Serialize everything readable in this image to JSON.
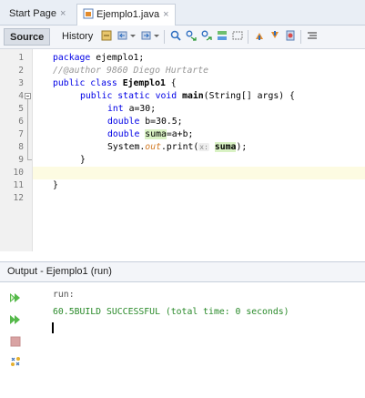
{
  "tabs": [
    {
      "label": "Start Page",
      "active": false
    },
    {
      "label": "Ejemplo1.java",
      "active": true
    }
  ],
  "close_glyph": "×",
  "toolbar": {
    "source_label": "Source",
    "history_label": "History"
  },
  "line_numbers": [
    "1",
    "2",
    "3",
    "4",
    "5",
    "6",
    "7",
    "8",
    "9",
    "10",
    "11",
    "12"
  ],
  "code": {
    "l1_kw": "package",
    "l1_rest": " ejemplo1;",
    "l2": "//@author 9860 Diego Hurtarte",
    "l3_kw": "public class",
    "l3_name": "Ejemplo1",
    "l3_rest": " {",
    "l4_kw": "public static void",
    "l4_name": "main",
    "l4_rest": "(String[] args) {",
    "l5_kw": "int",
    "l5_rest": " a=30;",
    "l6_kw": "double",
    "l6_rest": " b=30.5;",
    "l7_kw": "double",
    "l7_var": "suma",
    "l7_rest": "=a+b;",
    "l8_a": "System.",
    "l8_field": "out",
    "l8_b": ".print(",
    "l8_hint": "x:",
    "l8_var": "suma",
    "l8_c": ");",
    "l9": "}",
    "l11": "}"
  },
  "output": {
    "title": "Output - Ejemplo1 (run)",
    "line1": "run:",
    "line2": "60.5BUILD SUCCESSFUL (total time: 0 seconds)"
  },
  "colors": {
    "keyword": "#0000e6",
    "comment": "#969696",
    "success": "#2a8a2a",
    "highlight": "#d9f2c4",
    "current_line": "#fdfbe2"
  },
  "icons": [
    "java-file-icon",
    "back-icon",
    "forward-icon",
    "search-icon",
    "toggle-bookmark-icon",
    "format-icon",
    "comment-icon",
    "run-icon",
    "stop-icon",
    "rerun-icon"
  ]
}
